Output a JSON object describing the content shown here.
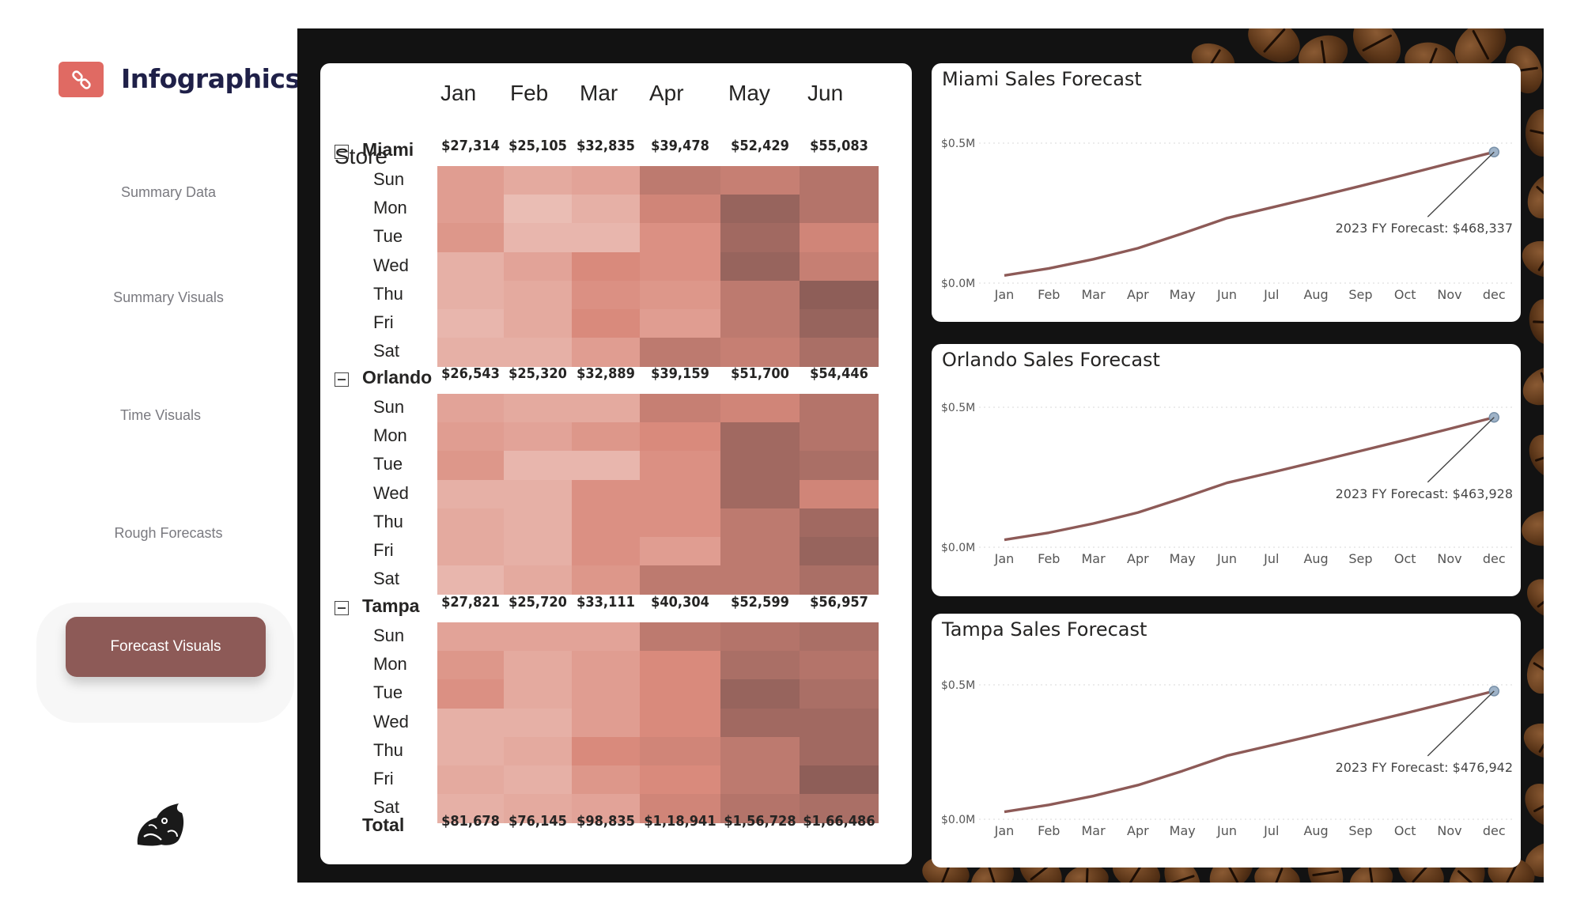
{
  "app": {
    "title": "Infographics",
    "logo_icon": "link-icon"
  },
  "nav": {
    "items": [
      {
        "label": "Summary Data"
      },
      {
        "label": "Summary Visuals"
      },
      {
        "label": "Time Visuals"
      },
      {
        "label": "Rough Forecasts"
      },
      {
        "label": "Forecast Visuals"
      }
    ],
    "active_label": "Forecast Visuals"
  },
  "matrix": {
    "header_store": "Store",
    "months": [
      "Jan",
      "Feb",
      "Mar",
      "Apr",
      "May",
      "Jun"
    ],
    "days": [
      "Sun",
      "Mon",
      "Tue",
      "Wed",
      "Thu",
      "Fri",
      "Sat"
    ],
    "stores": [
      {
        "name": "Miami",
        "subtotals": [
          "$27,314",
          "$25,105",
          "$32,835",
          "$39,478",
          "$52,429",
          "$55,083"
        ],
        "intensity": [
          [
            0.45,
            0.35,
            0.4,
            0.75,
            0.7,
            0.8
          ],
          [
            0.45,
            0.2,
            0.3,
            0.65,
            0.95,
            0.8
          ],
          [
            0.5,
            0.25,
            0.25,
            0.55,
            0.9,
            0.65
          ],
          [
            0.3,
            0.4,
            0.6,
            0.55,
            0.95,
            0.7
          ],
          [
            0.3,
            0.35,
            0.55,
            0.5,
            0.75,
            1.0
          ],
          [
            0.25,
            0.35,
            0.6,
            0.45,
            0.75,
            0.95
          ],
          [
            0.3,
            0.3,
            0.45,
            0.75,
            0.7,
            0.85
          ]
        ]
      },
      {
        "name": "Orlando",
        "subtotals": [
          "$26,543",
          "$25,320",
          "$32,889",
          "$39,159",
          "$51,700",
          "$54,446"
        ],
        "intensity": [
          [
            0.4,
            0.35,
            0.35,
            0.7,
            0.65,
            0.8
          ],
          [
            0.45,
            0.4,
            0.5,
            0.6,
            0.9,
            0.8
          ],
          [
            0.5,
            0.25,
            0.25,
            0.55,
            0.9,
            0.85
          ],
          [
            0.3,
            0.3,
            0.55,
            0.55,
            0.9,
            0.65
          ],
          [
            0.35,
            0.3,
            0.55,
            0.55,
            0.75,
            0.9
          ],
          [
            0.35,
            0.3,
            0.55,
            0.45,
            0.75,
            0.95
          ],
          [
            0.25,
            0.35,
            0.5,
            0.75,
            0.75,
            0.85
          ]
        ]
      },
      {
        "name": "Tampa",
        "subtotals": [
          "$27,821",
          "$25,720",
          "$33,111",
          "$40,304",
          "$52,599",
          "$56,957"
        ],
        "intensity": [
          [
            0.4,
            0.4,
            0.4,
            0.75,
            0.8,
            0.85
          ],
          [
            0.5,
            0.35,
            0.45,
            0.6,
            0.85,
            0.8
          ],
          [
            0.55,
            0.35,
            0.45,
            0.6,
            0.95,
            0.85
          ],
          [
            0.3,
            0.3,
            0.45,
            0.6,
            0.9,
            0.9
          ],
          [
            0.3,
            0.35,
            0.6,
            0.65,
            0.75,
            0.9
          ],
          [
            0.35,
            0.3,
            0.5,
            0.6,
            0.75,
            1.0
          ],
          [
            0.3,
            0.35,
            0.4,
            0.65,
            0.8,
            0.85
          ]
        ]
      }
    ],
    "total_label": "Total",
    "totals": [
      "$81,678",
      "$76,145",
      "$98,835",
      "$1,18,941",
      "$1,56,728",
      "$1,66,486"
    ]
  },
  "chart_data": [
    {
      "type": "line",
      "title": "Miami Sales Forecast",
      "categories": [
        "Jan",
        "Feb",
        "Mar",
        "Apr",
        "May",
        "Jun",
        "Jul",
        "Aug",
        "Sep",
        "Oct",
        "Nov",
        "dec"
      ],
      "values": [
        27314,
        52419,
        85254,
        124732,
        177161,
        232244,
        270000,
        308000,
        347000,
        387000,
        428000,
        468337
      ],
      "yticks": [
        "$0.0M",
        "$0.5M"
      ],
      "ylim": [
        0,
        500000
      ],
      "annotation": "2023 FY Forecast: $468,337"
    },
    {
      "type": "line",
      "title": "Orlando Sales Forecast",
      "categories": [
        "Jan",
        "Feb",
        "Mar",
        "Apr",
        "May",
        "Jun",
        "Jul",
        "Aug",
        "Sep",
        "Oct",
        "Nov",
        "dec"
      ],
      "values": [
        26543,
        51863,
        84752,
        123911,
        175611,
        230057,
        267000,
        305000,
        344000,
        383000,
        423000,
        463928
      ],
      "yticks": [
        "$0.0M",
        "$0.5M"
      ],
      "ylim": [
        0,
        500000
      ],
      "annotation": "2023 FY Forecast: $463,928"
    },
    {
      "type": "line",
      "title": "Tampa Sales Forecast",
      "categories": [
        "Jan",
        "Feb",
        "Mar",
        "Apr",
        "May",
        "Jun",
        "Jul",
        "Aug",
        "Sep",
        "Oct",
        "Nov",
        "dec"
      ],
      "values": [
        27821,
        53541,
        86652,
        126956,
        179555,
        236512,
        275000,
        314000,
        354000,
        394000,
        435000,
        476942
      ],
      "yticks": [
        "$0.0M",
        "$0.5M"
      ],
      "ylim": [
        0,
        500000
      ],
      "annotation": "2023 FY Forecast: $476,942"
    }
  ],
  "colors": {
    "accent": "#e06a63",
    "nav_active": "#8d5a57",
    "line": "#8d5a57",
    "heat_low": "#f3d6d0",
    "heat_mid": "#d98a7c",
    "heat_high": "#8e5e58"
  }
}
